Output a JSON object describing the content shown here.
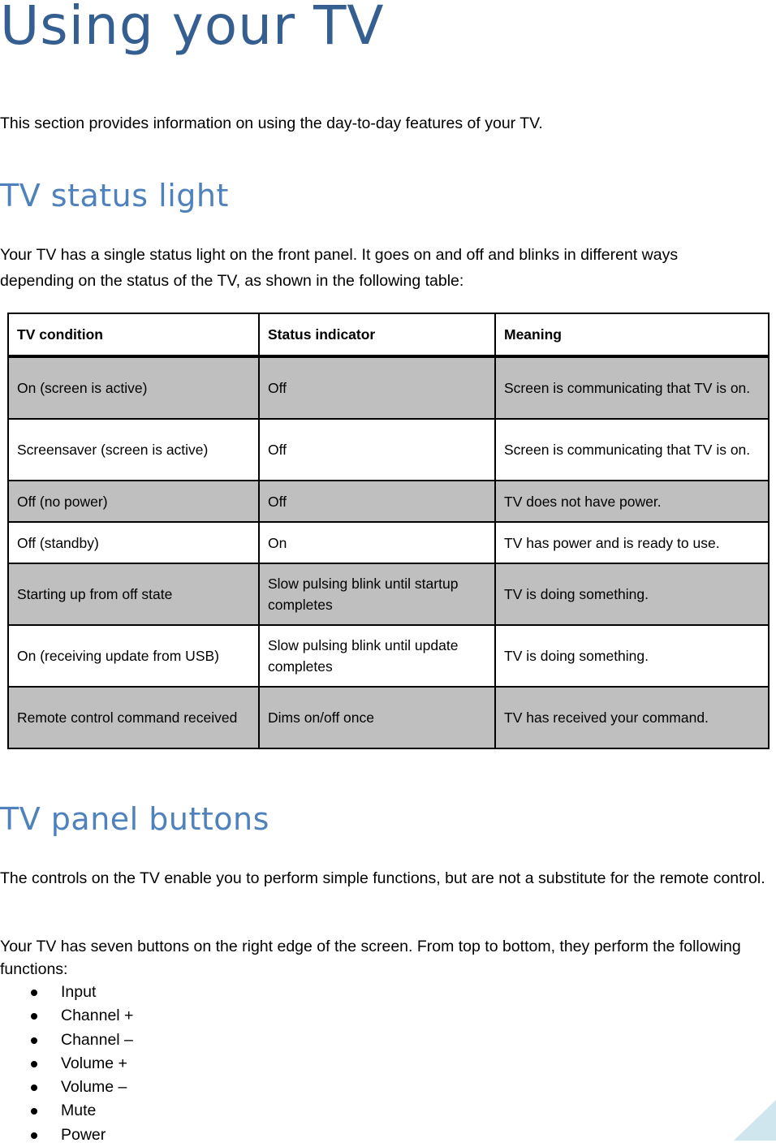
{
  "title": "Using your TV",
  "intro": "This section provides information on using the day-to-day features of your TV.",
  "status_section": {
    "heading": "TV status light",
    "description": "Your TV has a single status light on the front panel. It goes on and off and blinks in different ways depending on the status of the TV, as shown in the following table:",
    "table": {
      "headers": [
        "TV condition",
        "Status indicator",
        "Meaning"
      ],
      "rows": [
        {
          "condition": "On (screen is active)",
          "indicator": "Off",
          "meaning": "Screen is communicating that TV is on.",
          "shaded": true
        },
        {
          "condition": "Screensaver (screen is active)",
          "indicator": "Off",
          "meaning": "Screen is communicating that TV is on.",
          "shaded": false
        },
        {
          "condition": "Off (no power)",
          "indicator": "Off",
          "meaning": "TV does not have power.",
          "shaded": true
        },
        {
          "condition": "Off (standby)",
          "indicator": "On",
          "meaning": "TV has power and is ready to use.",
          "shaded": false
        },
        {
          "condition": "Starting up from off state",
          "indicator": "Slow pulsing blink until startup completes",
          "meaning": "TV is doing something.",
          "shaded": true
        },
        {
          "condition": "On (receiving update from USB)",
          "indicator": "Slow pulsing blink until update completes",
          "meaning": "TV is doing something.",
          "shaded": false
        },
        {
          "condition": "Remote control command received",
          "indicator": "Dims on/off once",
          "meaning": "TV has received your command.",
          "shaded": true
        }
      ]
    }
  },
  "buttons_section": {
    "heading": "TV panel buttons",
    "paragraph1": "The controls on the TV enable you to perform simple functions, but are not a substitute for the remote control.",
    "paragraph2": "Your TV has seven buttons on the right edge of the screen. From top to bottom, they perform the following functions:",
    "functions": [
      "Input",
      "Channel +",
      "Channel –",
      "Volume +",
      "Volume –",
      "Mute",
      "Power"
    ]
  },
  "colors": {
    "title": "#365f91",
    "heading": "#4f81bd",
    "row_shade": "#bfbfbf",
    "corner_accent": "#cfe6ef"
  }
}
